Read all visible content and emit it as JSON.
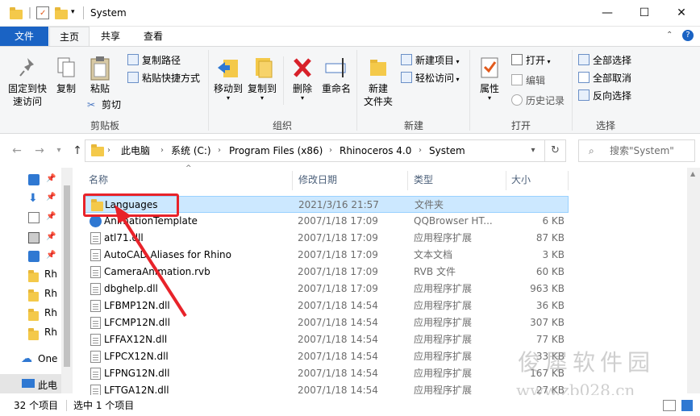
{
  "window": {
    "title": "System"
  },
  "window_controls": {
    "minimize": "—",
    "maximize": "☐",
    "close": "✕"
  },
  "tabs": {
    "file": "文件",
    "home": "主页",
    "share": "共享",
    "view": "查看"
  },
  "ribbon": {
    "pin": "固定到快\n速访问",
    "copy": "复制",
    "paste": "粘贴",
    "copy_path": "复制路径",
    "paste_shortcut": "粘贴快捷方式",
    "cut": "剪切",
    "group_clipboard": "剪贴板",
    "move_to": "移动到",
    "copy_to": "复制到",
    "delete": "删除",
    "rename": "重命名",
    "group_organize": "组织",
    "new_folder": "新建\n文件夹",
    "new_item": "新建项目",
    "easy_access": "轻松访问",
    "group_new": "新建",
    "properties": "属性",
    "open": "打开",
    "edit": "编辑",
    "history": "历史记录",
    "group_open": "打开",
    "select_all": "全部选择",
    "select_none": "全部取消",
    "invert": "反向选择",
    "group_select": "选择"
  },
  "breadcrumb": [
    "此电脑",
    "系统 (C:)",
    "Program Files (x86)",
    "Rhinoceros 4.0",
    "System"
  ],
  "search": {
    "placeholder": "搜索\"System\""
  },
  "nav_items": [
    "Rh",
    "Rh",
    "Rh",
    "Rh",
    "One",
    "此电"
  ],
  "columns": {
    "name": "名称",
    "date": "修改日期",
    "type": "类型",
    "size": "大小"
  },
  "files": [
    {
      "name": "Languages",
      "date": "2021/3/16 21:57",
      "type": "文件夹",
      "size": ""
    },
    {
      "name": "AnimationTemplate",
      "date": "2007/1/18 17:09",
      "type": "QQBrowser HT...",
      "size": "6 KB"
    },
    {
      "name": "atl71.dll",
      "date": "2007/1/18 17:09",
      "type": "应用程序扩展",
      "size": "87 KB"
    },
    {
      "name": "AutoCAD Aliases for Rhino",
      "date": "2007/1/18 17:09",
      "type": "文本文档",
      "size": "3 KB"
    },
    {
      "name": "CameraAnimation.rvb",
      "date": "2007/1/18 17:09",
      "type": "RVB 文件",
      "size": "60 KB"
    },
    {
      "name": "dbghelp.dll",
      "date": "2007/1/18 17:09",
      "type": "应用程序扩展",
      "size": "963 KB"
    },
    {
      "name": "LFBMP12N.dll",
      "date": "2007/1/18 14:54",
      "type": "应用程序扩展",
      "size": "36 KB"
    },
    {
      "name": "LFCMP12N.dll",
      "date": "2007/1/18 14:54",
      "type": "应用程序扩展",
      "size": "307 KB"
    },
    {
      "name": "LFFAX12N.dll",
      "date": "2007/1/18 14:54",
      "type": "应用程序扩展",
      "size": "77 KB"
    },
    {
      "name": "LFPCX12N.dll",
      "date": "2007/1/18 14:54",
      "type": "应用程序扩展",
      "size": "33 KB"
    },
    {
      "name": "LFPNG12N.dll",
      "date": "2007/1/18 14:54",
      "type": "应用程序扩展",
      "size": "167 KB"
    },
    {
      "name": "LFTGA12N.dll",
      "date": "2007/1/18 14:54",
      "type": "应用程序扩展",
      "size": "27 KB"
    }
  ],
  "status": {
    "count": "32 个项目",
    "selected": "选中 1 个项目"
  },
  "watermark": {
    "line1": "俊犀软件园",
    "line2": "www.zb028.cn"
  },
  "colors": {
    "accent": "#1a63c4",
    "selection": "#cce8ff",
    "highlight_box": "#e8232a"
  }
}
